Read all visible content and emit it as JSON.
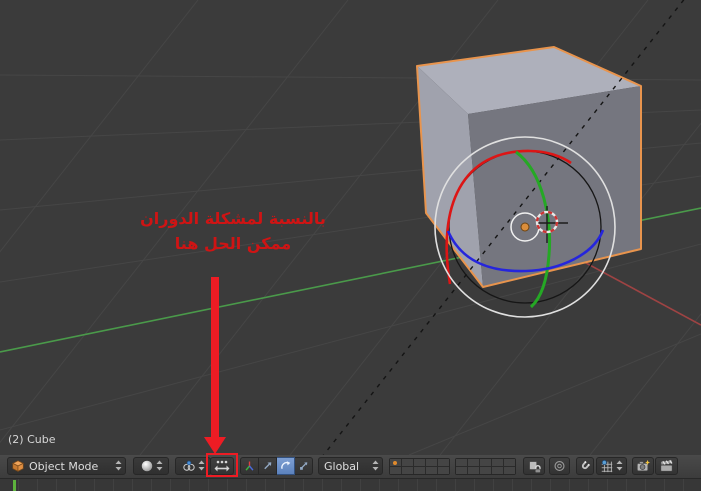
{
  "viewport": {
    "info_text": "(2) Cube",
    "annotation": {
      "line1": "بالنسبة لمشكلة الدوران",
      "line2": "ممكن الحل هنا"
    }
  },
  "header": {
    "mode_label": "Object Mode",
    "orientation_label": "Global",
    "icon_names": [
      "cube-icon",
      "shading-sphere-icon",
      "pivot-point-icon",
      "manipulator-toggle-icon",
      "axis-widget-icon",
      "translate-widget-icon",
      "rotate-widget-icon",
      "scale-widget-icon",
      "layers-grid",
      "lock-icon",
      "proportional-edit-icon",
      "magnet-snap-icon",
      "snap-element-icon",
      "opengl-render-camera-icon",
      "opengl-render-anim-icon",
      "updown-arrows-icon"
    ]
  },
  "scene": {
    "selected_object": "Cube",
    "active_tool": "rotate-manipulator",
    "layers_active_index": 0
  },
  "colors": {
    "annotation_red": "#ed1c24",
    "selection_outline_orange": "#e8944d",
    "grid_axis_green": "#4a9a4a",
    "grid_axis_red": "#9e4343",
    "gizmo_x_red": "#dd1515",
    "gizmo_y_green": "#25a825",
    "gizmo_z_blue": "#2525dd",
    "active_button_blue": "#6c92c4",
    "layer_dot_orange": "#e08a2d",
    "playhead_green": "#5db33d"
  }
}
